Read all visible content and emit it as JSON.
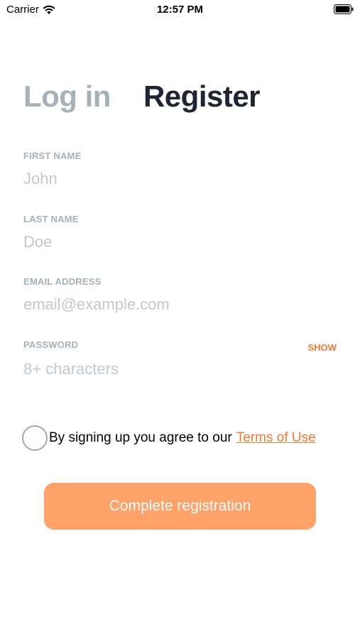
{
  "status_bar": {
    "carrier": "Carrier",
    "time": "12:57 PM"
  },
  "tabs": [
    {
      "label": "Log in",
      "active": false
    },
    {
      "label": "Register",
      "active": true
    }
  ],
  "form": {
    "first_name": {
      "label": "FIRST NAME",
      "placeholder": "John",
      "value": ""
    },
    "last_name": {
      "label": "LAST NAME",
      "placeholder": "Doe",
      "value": ""
    },
    "email": {
      "label": "EMAIL ADDRESS",
      "placeholder": "email@example.com",
      "value": ""
    },
    "password": {
      "label": "PASSWORD",
      "placeholder": "8+ characters",
      "value": "",
      "toggle_label": "SHOW"
    }
  },
  "terms": {
    "text": "By signing up you agree to our",
    "link_label": "Terms of Use",
    "checked": false
  },
  "submit": {
    "label": "Complete registration"
  },
  "colors": {
    "accent": "#f07b32",
    "button_bg": "#fea269",
    "inactive_tab": "#a7b1b8",
    "active_tab": "#1f2433"
  }
}
